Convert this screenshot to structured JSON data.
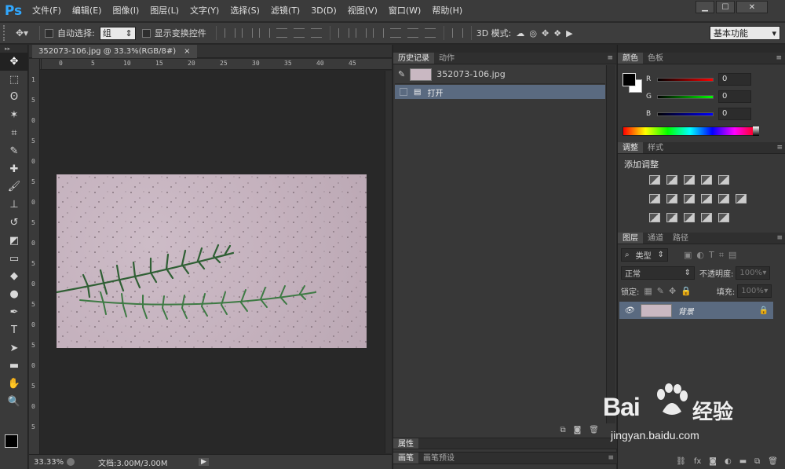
{
  "app": {
    "logo": "Ps"
  },
  "menu": [
    "文件(F)",
    "编辑(E)",
    "图像(I)",
    "图层(L)",
    "文字(Y)",
    "选择(S)",
    "滤镜(T)",
    "3D(D)",
    "视图(V)",
    "窗口(W)",
    "帮助(H)"
  ],
  "window_controls": {
    "minimize": "▁",
    "maximize": "☐",
    "close": "✕"
  },
  "options_bar": {
    "auto_select_label": "自动选择:",
    "auto_select_value": "组",
    "show_transform_label": "显示变换控件",
    "mode_3d_label": "3D 模式:",
    "workspace": "基本功能"
  },
  "tools": [
    {
      "name": "move-tool",
      "glyph": "✥"
    },
    {
      "name": "marquee-tool",
      "glyph": "⬚"
    },
    {
      "name": "lasso-tool",
      "glyph": "ʘ"
    },
    {
      "name": "magic-wand-tool",
      "glyph": "✶"
    },
    {
      "name": "crop-tool",
      "glyph": "⌗"
    },
    {
      "name": "eyedropper-tool",
      "glyph": "✎"
    },
    {
      "name": "healing-tool",
      "glyph": "✚"
    },
    {
      "name": "brush-tool",
      "glyph": "🖌"
    },
    {
      "name": "stamp-tool",
      "glyph": "⊥"
    },
    {
      "name": "history-brush-tool",
      "glyph": "↺"
    },
    {
      "name": "eraser-tool",
      "glyph": "◩"
    },
    {
      "name": "gradient-tool",
      "glyph": "▭"
    },
    {
      "name": "blur-tool",
      "glyph": "◆"
    },
    {
      "name": "dodge-tool",
      "glyph": "●"
    },
    {
      "name": "pen-tool",
      "glyph": "✒"
    },
    {
      "name": "type-tool",
      "glyph": "T"
    },
    {
      "name": "path-select-tool",
      "glyph": "➤"
    },
    {
      "name": "shape-tool",
      "glyph": "▬"
    },
    {
      "name": "hand-tool",
      "glyph": "✋"
    },
    {
      "name": "zoom-tool",
      "glyph": "🔍"
    }
  ],
  "document": {
    "tab_title": "352073-106.jpg @ 33.3%(RGB/8#)",
    "tab_close": "×",
    "ruler_h": [
      "0",
      "5",
      "10",
      "15",
      "20",
      "25",
      "30",
      "35",
      "40",
      "45"
    ],
    "ruler_v": [
      "1",
      "5",
      "0",
      "5",
      "0",
      "5",
      "0",
      "5",
      "0",
      "5",
      "0",
      "5",
      "0",
      "5",
      "0",
      "5",
      "0",
      "5"
    ],
    "zoom": "33.33%",
    "doc_info": "文档:3.00M/3.00M"
  },
  "history_panel": {
    "tabs": [
      "历史记录",
      "动作"
    ],
    "snapshot": "352073-106.jpg",
    "steps": [
      "打开"
    ]
  },
  "properties_tab": "属性",
  "brush_tabs": [
    "画笔",
    "画笔预设"
  ],
  "color_panel": {
    "tabs": [
      "颜色",
      "色板"
    ],
    "r_label": "R",
    "g_label": "G",
    "b_label": "B",
    "r": "0",
    "g": "0",
    "b": "0"
  },
  "adjust_panel": {
    "tabs": [
      "调整",
      "样式"
    ],
    "title": "添加调整"
  },
  "layers_panel": {
    "tabs": [
      "图层",
      "通道",
      "路径"
    ],
    "filter_label": "类型",
    "blend_mode": "正常",
    "opacity_label": "不透明度:",
    "opacity": "100%",
    "lock_label": "锁定:",
    "fill_label": "填充:",
    "fill": "100%",
    "layers": [
      {
        "name": "背景"
      }
    ]
  },
  "watermark": {
    "brand": "Bai",
    "brand_cn": "经验",
    "url": "jingyan.baidu.com"
  }
}
